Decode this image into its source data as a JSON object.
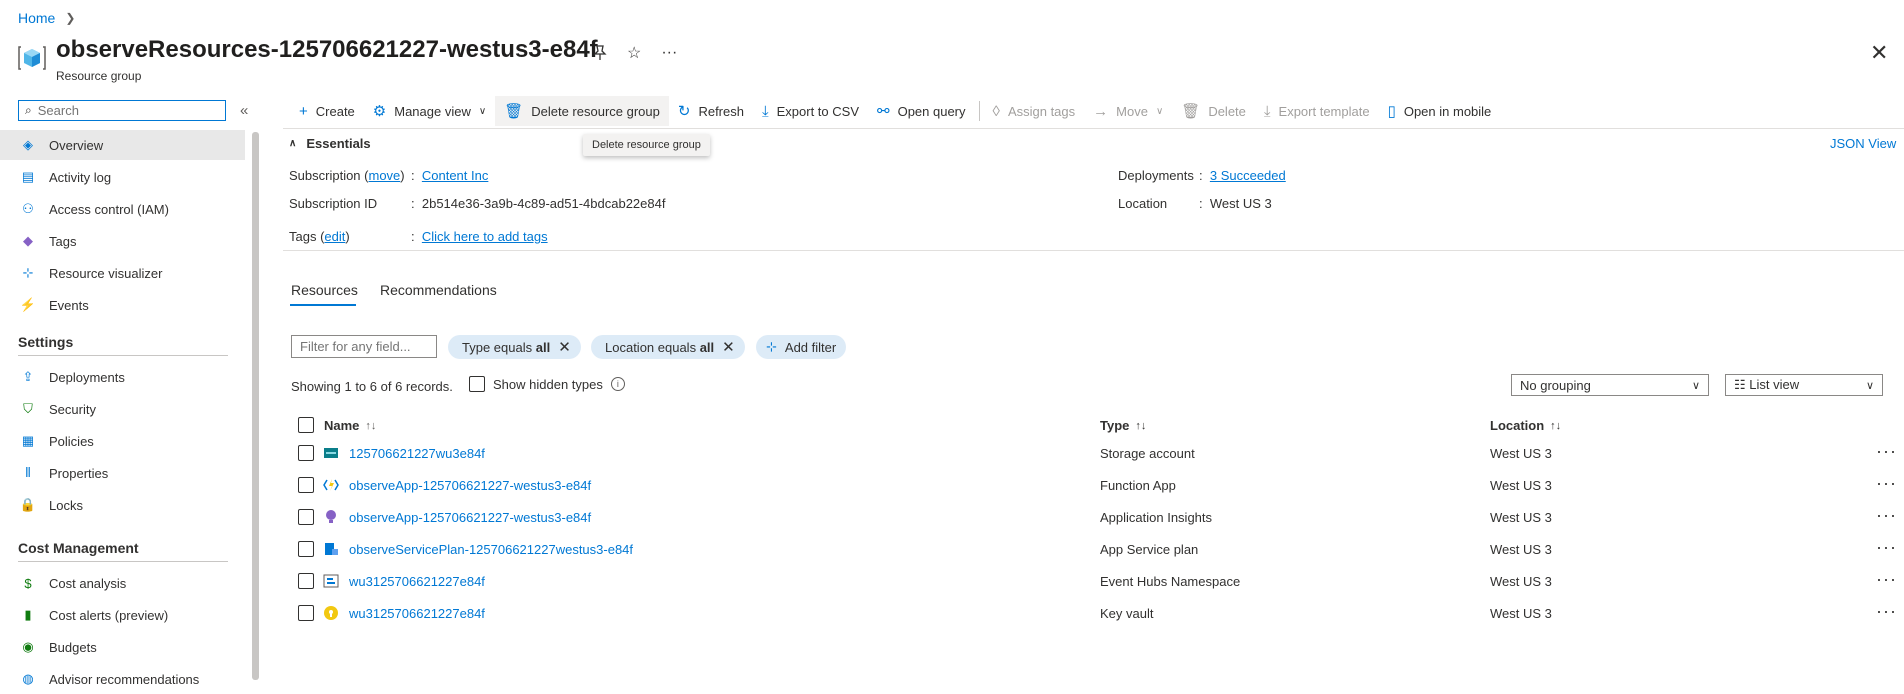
{
  "breadcrumb": {
    "home": "Home",
    "sep": ">"
  },
  "header": {
    "title": "observeResources-125706621227-westus3-e84f",
    "subtitle": "Resource group",
    "pin_icon": "pin-icon",
    "star_icon": "star-icon",
    "more": "···",
    "close": "✕"
  },
  "sidebar": {
    "search_placeholder": "Search",
    "collapse": "«",
    "items": [
      {
        "label": "Overview",
        "icon": "overview-icon",
        "glyph": "◈",
        "color": "#0078d4"
      },
      {
        "label": "Activity log",
        "icon": "activity-log-icon",
        "glyph": "▤",
        "color": "#0078d4"
      },
      {
        "label": "Access control (IAM)",
        "icon": "people-icon",
        "glyph": "⚇",
        "color": "#0078d4"
      },
      {
        "label": "Tags",
        "icon": "tag-icon",
        "glyph": "◆",
        "color": "#8661c5"
      },
      {
        "label": "Resource visualizer",
        "icon": "visualizer-icon",
        "glyph": "⊹",
        "color": "#0078d4"
      },
      {
        "label": "Events",
        "icon": "lightning-icon",
        "glyph": "⚡",
        "color": "#f2c811"
      }
    ],
    "settings_title": "Settings",
    "settings_items": [
      {
        "label": "Deployments",
        "icon": "deployments-icon",
        "glyph": "⇪",
        "color": "#0078d4"
      },
      {
        "label": "Security",
        "icon": "shield-icon",
        "glyph": "⛉",
        "color": "#107c10"
      },
      {
        "label": "Policies",
        "icon": "policies-icon",
        "glyph": "▦",
        "color": "#0078d4"
      },
      {
        "label": "Properties",
        "icon": "properties-icon",
        "glyph": "⦀",
        "color": "#0078d4"
      },
      {
        "label": "Locks",
        "icon": "lock-icon",
        "glyph": "🔒",
        "color": "#0078d4"
      }
    ],
    "cost_title": "Cost Management",
    "cost_items": [
      {
        "label": "Cost analysis",
        "icon": "cost-analysis-icon",
        "glyph": "$",
        "color": "#107c10"
      },
      {
        "label": "Cost alerts (preview)",
        "icon": "cost-alerts-icon",
        "glyph": "▮",
        "color": "#107c10"
      },
      {
        "label": "Budgets",
        "icon": "budgets-icon",
        "glyph": "◉",
        "color": "#107c10"
      },
      {
        "label": "Advisor recommendations",
        "icon": "advisor-icon",
        "glyph": "◍",
        "color": "#0078d4"
      }
    ]
  },
  "commands": {
    "create": "Create",
    "manage_view": "Manage view",
    "delete_rg": "Delete resource group",
    "refresh": "Refresh",
    "export_csv": "Export to CSV",
    "open_query": "Open query",
    "assign_tags": "Assign tags",
    "move": "Move",
    "delete": "Delete",
    "export_template": "Export template",
    "open_mobile": "Open in mobile",
    "tooltip": "Delete resource group"
  },
  "essentials": {
    "title": "Essentials",
    "json_view": "JSON View",
    "subscription_label": "Subscription",
    "move_link": "move",
    "subscription_value": "Content Inc",
    "subscription_id_label": "Subscription ID",
    "subscription_id_value": "2b514e36-3a9b-4c89-ad51-4bdcab22e84f",
    "tags_label": "Tags",
    "edit_link": "edit",
    "tags_value": "Click here to add tags",
    "deployments_label": "Deployments",
    "deployments_value": "3 Succeeded",
    "location_label": "Location",
    "location_value": "West US 3",
    "colon": ":"
  },
  "tabs": {
    "resources": "Resources",
    "recommendations": "Recommendations"
  },
  "filters": {
    "placeholder": "Filter for any field...",
    "type_pill_prefix": "Type equals",
    "type_pill_value": "all",
    "location_pill_prefix": "Location equals",
    "location_pill_value": "all",
    "add_filter": "Add filter"
  },
  "records_text": "Showing 1 to 6 of 6 records.",
  "show_hidden": "Show hidden types",
  "grouping": "No grouping",
  "view_mode": "List view",
  "table": {
    "headers": {
      "name": "Name",
      "type": "Type",
      "location": "Location"
    },
    "rows": [
      {
        "name": "125706621227wu3e84f",
        "type": "Storage account",
        "location": "West US 3",
        "icon": "storage-icon"
      },
      {
        "name": "observeApp-125706621227-westus3-e84f",
        "type": "Function App",
        "location": "West US 3",
        "icon": "function-app-icon"
      },
      {
        "name": "observeApp-125706621227-westus3-e84f",
        "type": "Application Insights",
        "location": "West US 3",
        "icon": "app-insights-icon"
      },
      {
        "name": "observeServicePlan-125706621227westus3-e84f",
        "type": "App Service plan",
        "location": "West US 3",
        "icon": "app-service-plan-icon"
      },
      {
        "name": "wu3125706621227e84f",
        "type": "Event Hubs Namespace",
        "location": "West US 3",
        "icon": "event-hubs-icon"
      },
      {
        "name": "wu3125706621227e84f",
        "type": "Key vault",
        "location": "West US 3",
        "icon": "key-vault-icon"
      }
    ]
  }
}
